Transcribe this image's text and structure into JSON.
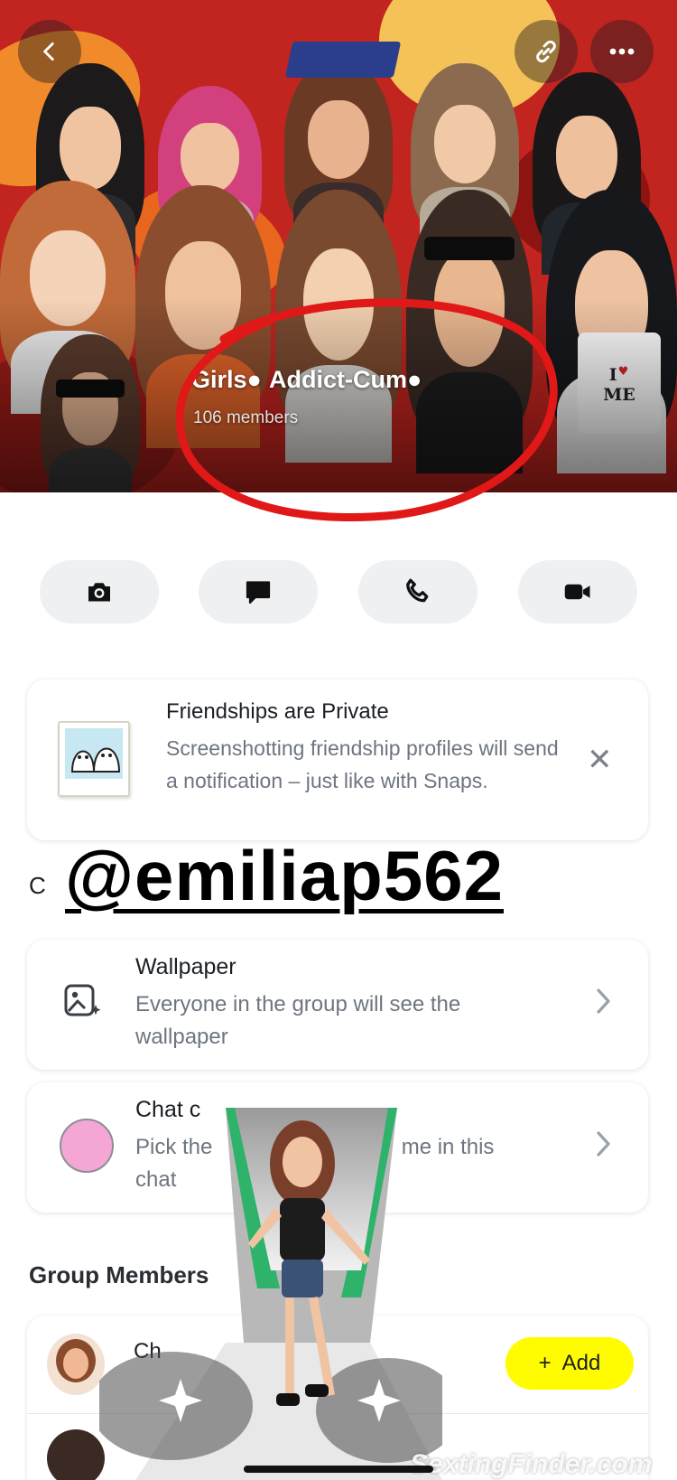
{
  "header": {
    "group_name_part1": "Girls",
    "group_name_part2": "Addict-Cum",
    "member_count": "106 members",
    "back_icon": "chevron-left-icon",
    "link_icon": "link-icon",
    "more_icon": "more-dots-icon",
    "sign_line1": "I",
    "sign_line2": "ME"
  },
  "actions": [
    {
      "icon": "camera-icon"
    },
    {
      "icon": "chat-bubble-icon"
    },
    {
      "icon": "phone-icon"
    },
    {
      "icon": "video-camera-icon"
    }
  ],
  "friendship_notice": {
    "title": "Friendships are Private",
    "description": "Screenshotting friendship profiles will send a notification – just like with Snaps.",
    "close_icon": "close-icon"
  },
  "overlay": {
    "handle": "@emiliap562",
    "partial_letter": "C",
    "site_watermark": "SextingFinder.com"
  },
  "settings": {
    "wallpaper": {
      "title": "Wallpaper",
      "description": "Everyone in the group will see the wallpaper"
    },
    "chat_color": {
      "title": "Chat c",
      "description_start": "Pick the",
      "description_end": "me in this",
      "description_line2": "chat",
      "swatch_color": "#f4a7d4"
    }
  },
  "members_section": {
    "label": "Group Members",
    "first_member_initial": "Ch",
    "add_label": "Add",
    "add_button_color": "#fffc00"
  },
  "colors": {
    "banner_red": "#c2241f",
    "annotation_red": "#e01818",
    "card_bg": "#ffffff",
    "secondary_text": "#6e7580"
  }
}
